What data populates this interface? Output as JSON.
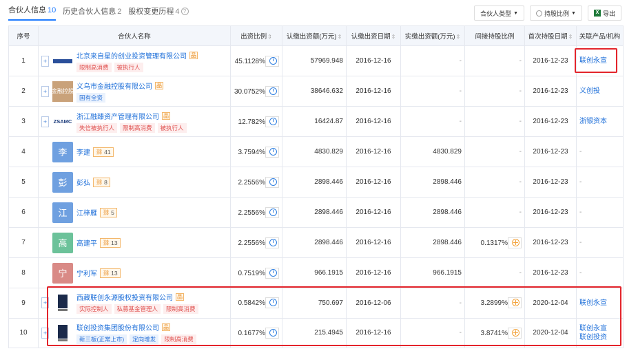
{
  "tabs": [
    {
      "label": "合伙人信息",
      "count": "10"
    },
    {
      "label": "历史合伙人信息",
      "count": "2"
    },
    {
      "label": "股权变更历程",
      "count": "4"
    }
  ],
  "toolbar": {
    "partner_type": "合伙人类型",
    "holding_ratio": "持股比例",
    "export": "导出"
  },
  "columns": [
    "序号",
    "合伙人名称",
    "出资比例",
    "认缴出资额(万元)",
    "认缴出资日期",
    "实缴出资额(万元)",
    "间接持股比例",
    "首次持股日期",
    "关联产品/机构"
  ],
  "rows": [
    {
      "idx": "1",
      "name": "北京来自星的创业投资管理有限公司",
      "tags": [
        {
          "t": "限制高消费",
          "c": "red"
        },
        {
          "t": "被执行人",
          "c": "red"
        }
      ],
      "ratio": "45.1128%",
      "sub": "57969.948",
      "sub_date": "2016-12-16",
      "paid": "-",
      "indirect": "-",
      "first": "2016-12-23",
      "products": [
        "联创永宣"
      ]
    },
    {
      "idx": "2",
      "name": "义乌市金融控股有限公司",
      "logo_text": "金融控股",
      "tags": [
        {
          "t": "国有全资",
          "c": "blue"
        }
      ],
      "ratio": "30.0752%",
      "sub": "38646.632",
      "sub_date": "2016-12-16",
      "paid": "-",
      "indirect": "-",
      "first": "2016-12-23",
      "products": [
        "义创投"
      ]
    },
    {
      "idx": "3",
      "name": "浙江融臻资产管理有限公司",
      "logo_text": "ZSAMC",
      "tags": [
        {
          "t": "失信被执行人",
          "c": "red"
        },
        {
          "t": "限制高消费",
          "c": "red"
        },
        {
          "t": "被执行人",
          "c": "red"
        }
      ],
      "ratio": "12.782%",
      "sub": "16424.87",
      "sub_date": "2016-12-16",
      "paid": "-",
      "indirect": "-",
      "first": "2016-12-23",
      "products": [
        "浙银资本"
      ]
    },
    {
      "idx": "4",
      "name": "李建",
      "avatar": "李",
      "avatar_color": "#6fa0e0",
      "count": "41",
      "ratio": "3.7594%",
      "sub": "4830.829",
      "sub_date": "2016-12-16",
      "paid": "4830.829",
      "indirect": "-",
      "first": "2016-12-23",
      "products": [
        "-"
      ]
    },
    {
      "idx": "5",
      "name": "彭弘",
      "avatar": "彭",
      "avatar_color": "#6fa0e0",
      "count": "8",
      "ratio": "2.2556%",
      "sub": "2898.446",
      "sub_date": "2016-12-16",
      "paid": "2898.446",
      "indirect": "-",
      "first": "2016-12-23",
      "products": [
        "-"
      ]
    },
    {
      "idx": "6",
      "name": "江梓雁",
      "avatar": "江",
      "avatar_color": "#6fa0e0",
      "count": "5",
      "ratio": "2.2556%",
      "sub": "2898.446",
      "sub_date": "2016-12-16",
      "paid": "2898.446",
      "indirect": "-",
      "first": "2016-12-23",
      "products": [
        "-"
      ]
    },
    {
      "idx": "7",
      "name": "高建平",
      "avatar": "高",
      "avatar_color": "#6cc29a",
      "count": "13",
      "ratio": "2.2556%",
      "sub": "2898.446",
      "sub_date": "2016-12-16",
      "paid": "2898.446",
      "indirect": "0.1317%",
      "first": "2016-12-23",
      "products": [
        "-"
      ]
    },
    {
      "idx": "8",
      "name": "宁利军",
      "avatar": "宁",
      "avatar_color": "#d98a86",
      "count": "13",
      "ratio": "0.7519%",
      "sub": "966.1915",
      "sub_date": "2016-12-16",
      "paid": "966.1915",
      "indirect": "-",
      "first": "2016-12-23",
      "products": [
        "-"
      ]
    },
    {
      "idx": "9",
      "name": "西藏联创永源股权投资有限公司",
      "tags": [
        {
          "t": "实际控制人",
          "c": "red"
        },
        {
          "t": "私募基金管理人",
          "c": "red"
        },
        {
          "t": "限制高消费",
          "c": "red"
        }
      ],
      "ratio": "0.5842%",
      "sub": "750.697",
      "sub_date": "2016-12-06",
      "paid": "-",
      "indirect": "3.2899%",
      "first": "2020-12-04",
      "products": [
        "联创永宣"
      ]
    },
    {
      "idx": "10",
      "name": "联创投资集团股份有限公司",
      "tags": [
        {
          "t": "新三板(正常上市)",
          "c": "blue"
        },
        {
          "t": "定向增发",
          "c": "blue"
        },
        {
          "t": "限制高消费",
          "c": "red"
        }
      ],
      "ratio": "0.1677%",
      "sub": "215.4945",
      "sub_date": "2016-12-16",
      "paid": "-",
      "indirect": "3.8741%",
      "first": "2020-12-04",
      "products": [
        "联创永宣",
        "联创投资"
      ]
    }
  ],
  "colors": {
    "accent": "#1e7bff",
    "highlight": "#e3242b",
    "link": "#1e6fd9",
    "tag_red": "#e0514f",
    "tag_blue": "#2a72d8"
  },
  "icons": {
    "expand": "plus-box-icon",
    "relation": "org-chart-icon",
    "ratio_history": "clock-icon",
    "indirect_chain": "crosshair-icon",
    "partner_type": "caret-down-icon",
    "holding": "clock-icon",
    "export": "excel-icon",
    "help": "help-circle-icon"
  }
}
